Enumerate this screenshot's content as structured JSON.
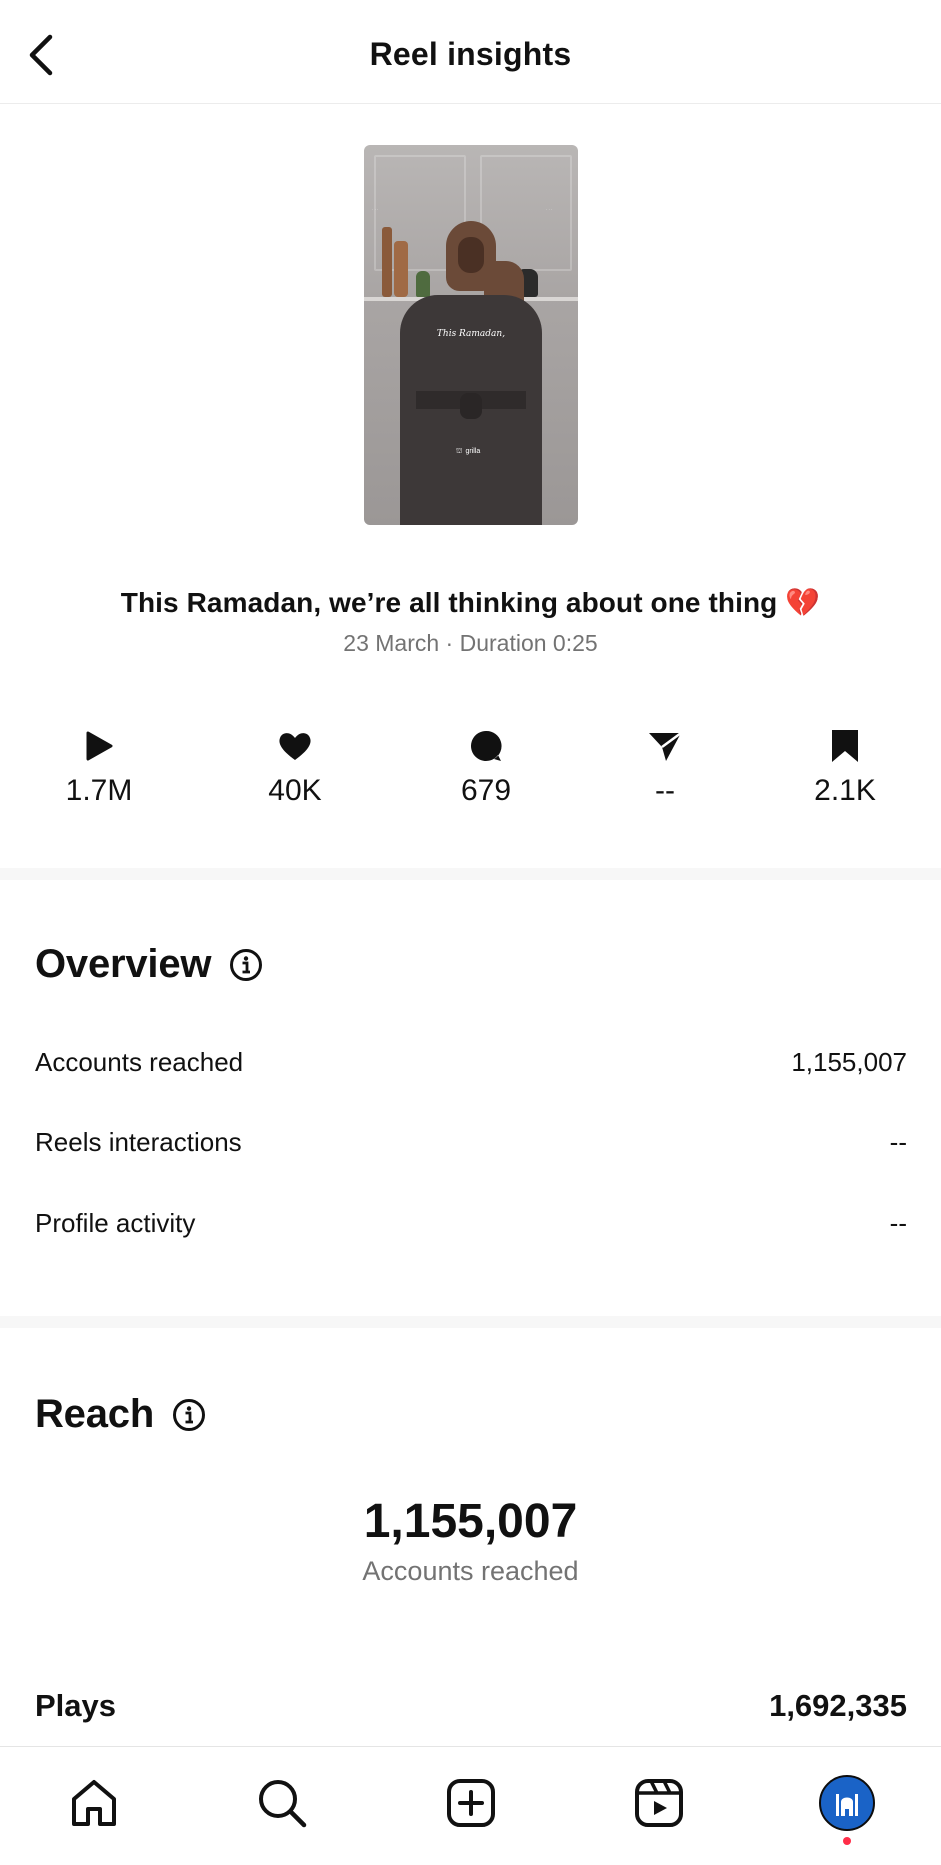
{
  "header": {
    "title": "Reel insights"
  },
  "reel": {
    "thumbnail_caption": "This Ramadan,",
    "thumbnail_brand": "grilla",
    "caption": "This Ramadan, we’re all thinking about one thing 💔",
    "meta": "23 March · Duration 0:25"
  },
  "stats": [
    {
      "icon": "play-icon",
      "value": "1.7M"
    },
    {
      "icon": "heart-icon",
      "value": "40K"
    },
    {
      "icon": "comment-icon",
      "value": "679"
    },
    {
      "icon": "share-icon",
      "value": "--"
    },
    {
      "icon": "bookmark-icon",
      "value": "2.1K"
    }
  ],
  "overview": {
    "title": "Overview",
    "rows": [
      {
        "label": "Accounts reached",
        "value": "1,155,007"
      },
      {
        "label": "Reels interactions",
        "value": "--"
      },
      {
        "label": "Profile activity",
        "value": "--"
      }
    ]
  },
  "reach": {
    "title": "Reach",
    "number": "1,155,007",
    "subtitle": "Accounts reached",
    "plays_label": "Plays",
    "plays_value": "1,692,335"
  },
  "nav": {
    "items": [
      "home-icon",
      "search-icon",
      "create-icon",
      "reels-icon",
      "profile-avatar"
    ],
    "accent": "#1a63c7",
    "notification_color": "#ff2d48"
  }
}
